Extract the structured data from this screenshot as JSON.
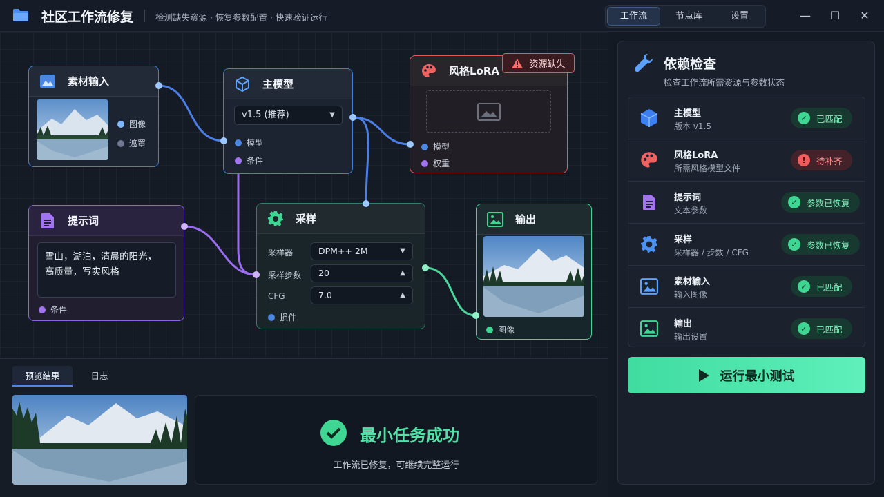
{
  "app": {
    "title": "社区工作流修复",
    "subtitle": "检测缺失资源 · 恢复参数配置 · 快速验证运行",
    "icon": "folder-icon"
  },
  "top_tabs": [
    {
      "label": "工作流",
      "active": true
    },
    {
      "label": "节点库",
      "active": false
    },
    {
      "label": "设置",
      "active": false
    }
  ],
  "window_controls": {
    "minimize": "—",
    "maximize": "☐",
    "close": "✕"
  },
  "nodes": {
    "input": {
      "title": "素材输入",
      "ports": [
        "图像",
        "遮罩"
      ]
    },
    "model": {
      "title": "主模型",
      "select": "v1.5 (推荐)",
      "ports": [
        "模型",
        "条件"
      ]
    },
    "lora": {
      "title": "风格LoRA",
      "badge": "资源缺失",
      "ports": [
        "模型",
        "权重"
      ]
    },
    "prompt": {
      "title": "提示词",
      "text_line1": "雪山，湖泊，清晨的阳光，",
      "text_line2": "高质量，写实风格",
      "port": "条件"
    },
    "sampler": {
      "title": "采样",
      "rows": [
        {
          "label": "采样器",
          "value": "DPM++ 2M"
        },
        {
          "label": "采样步数",
          "value": "20"
        },
        {
          "label": "CFG",
          "value": "7.0"
        }
      ],
      "port": "损件"
    },
    "output": {
      "title": "输出",
      "port": "图像"
    }
  },
  "bottom": {
    "tabs": [
      {
        "label": "预览结果",
        "active": true
      },
      {
        "label": "日志",
        "active": false
      }
    ],
    "success_title": "最小任务成功",
    "success_sub": "工作流已修复，可继续完整运行"
  },
  "deps": {
    "title": "依赖检查",
    "subtitle": "检查工作流所需资源与参数状态",
    "items": [
      {
        "name": "主模型",
        "desc": "版本 v1.5",
        "status": "已匹配",
        "state": "ok",
        "icon": "cube-icon"
      },
      {
        "name": "风格LoRA",
        "desc": "所需风格模型文件",
        "status": "待补齐",
        "state": "bad",
        "icon": "palette-icon"
      },
      {
        "name": "提示词",
        "desc": "文本参数",
        "status": "参数已恢复",
        "state": "ok",
        "icon": "document-icon"
      },
      {
        "name": "采样",
        "desc": "采样器 / 步数 / CFG",
        "status": "参数已恢复",
        "state": "ok",
        "icon": "gear-icon"
      },
      {
        "name": "素材输入",
        "desc": "输入图像",
        "status": "已匹配",
        "state": "ok",
        "icon": "image-icon"
      },
      {
        "name": "输出",
        "desc": "输出设置",
        "status": "已匹配",
        "state": "ok",
        "icon": "image-icon"
      }
    ],
    "run_label": "运行最小测试"
  },
  "colors": {
    "accent": "#3f7fd6",
    "success": "#53e0a6",
    "danger": "#e05a5a",
    "purple": "#9a6cf0"
  }
}
